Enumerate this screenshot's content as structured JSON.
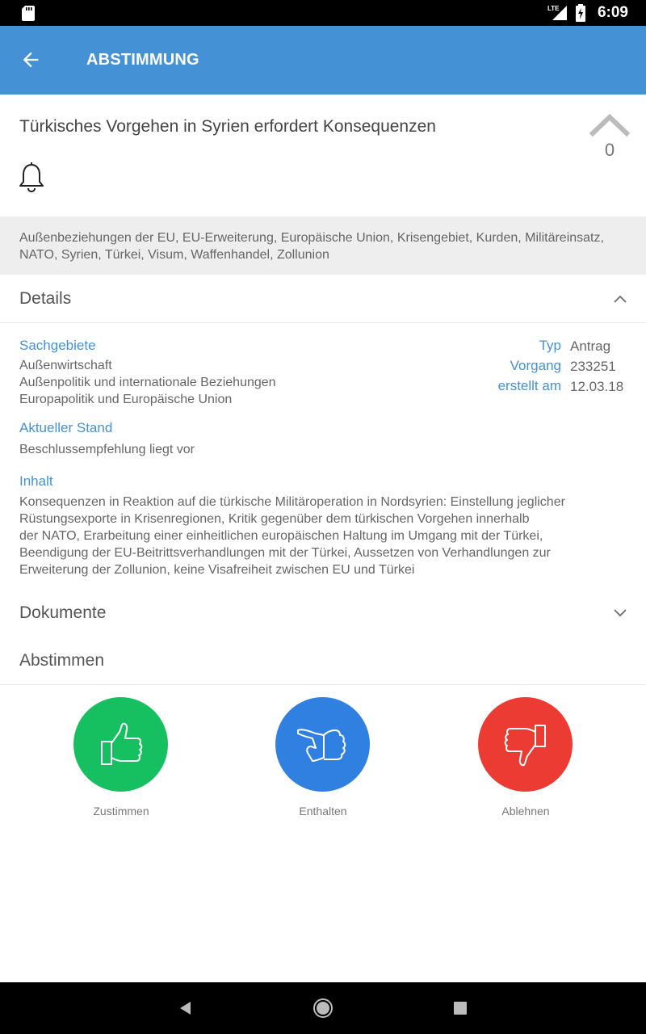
{
  "status_bar": {
    "time": "6:09",
    "network": "LTE",
    "icons": [
      "sd-card-icon",
      "lte-signal-icon",
      "battery-charging-icon"
    ]
  },
  "app_bar": {
    "title": "ABSTIMMUNG",
    "back_icon": "arrow-left-icon",
    "color": "#4491d6"
  },
  "motion": {
    "title": "Türkisches Vorgehen in Syrien erfordert Konsequenzen",
    "upvote_count": "0",
    "bell_icon": "bell-icon",
    "tags": "Außenbeziehungen der EU, EU-Erweiterung, Europäische Union, Krisengebiet, Kurden, Militäreinsatz, NATO, Syrien, Türkei, Visum, Waffenhandel, Zollunion"
  },
  "details": {
    "header": "Details",
    "sachgebiete_label": "Sachgebiete",
    "sachgebiete": [
      "Außenwirtschaft",
      "Außenpolitik und internationale Beziehungen",
      "Europapolitik und Europäische Union"
    ],
    "meta": [
      {
        "label": "Typ",
        "value": "Antrag"
      },
      {
        "label": "Vorgang",
        "value": "233251"
      },
      {
        "label": "erstellt am",
        "value": "12.03.18"
      }
    ],
    "stand_label": "Aktueller Stand",
    "stand_value": "Beschlussempfehlung liegt vor",
    "inhalt_label": "Inhalt",
    "inhalt_lines": [
      "Konsequenzen in Reaktion auf die türkische Militäroperation in Nordsyrien: Einstellung jeglicher",
      "Rüstungsexporte in Krisenregionen, Kritik gegenüber dem türkischen Vorgehen innerhalb",
      "der NATO, Erarbeitung einer einheitlichen europäischen Haltung im Umgang mit der Türkei,",
      "Beendigung der EU-Beitrittsverhandlungen mit der Türkei, Aussetzen von Verhandlungen zur",
      "Erweiterung der Zollunion, keine Visafreiheit zwischen EU und Türkei"
    ]
  },
  "documents": {
    "header": "Dokumente"
  },
  "vote": {
    "header": "Abstimmen",
    "options": [
      {
        "label": "Zustimmen",
        "color": "#16c060",
        "icon": "thumbs-up-icon"
      },
      {
        "label": "Enthalten",
        "color": "#2f80e0",
        "icon": "thumbs-sideways-icon"
      },
      {
        "label": "Ablehnen",
        "color": "#ec3b32",
        "icon": "thumbs-down-icon"
      }
    ]
  },
  "nav_bar": {
    "icons": [
      "nav-back-icon",
      "nav-home-icon",
      "nav-recents-icon"
    ]
  }
}
